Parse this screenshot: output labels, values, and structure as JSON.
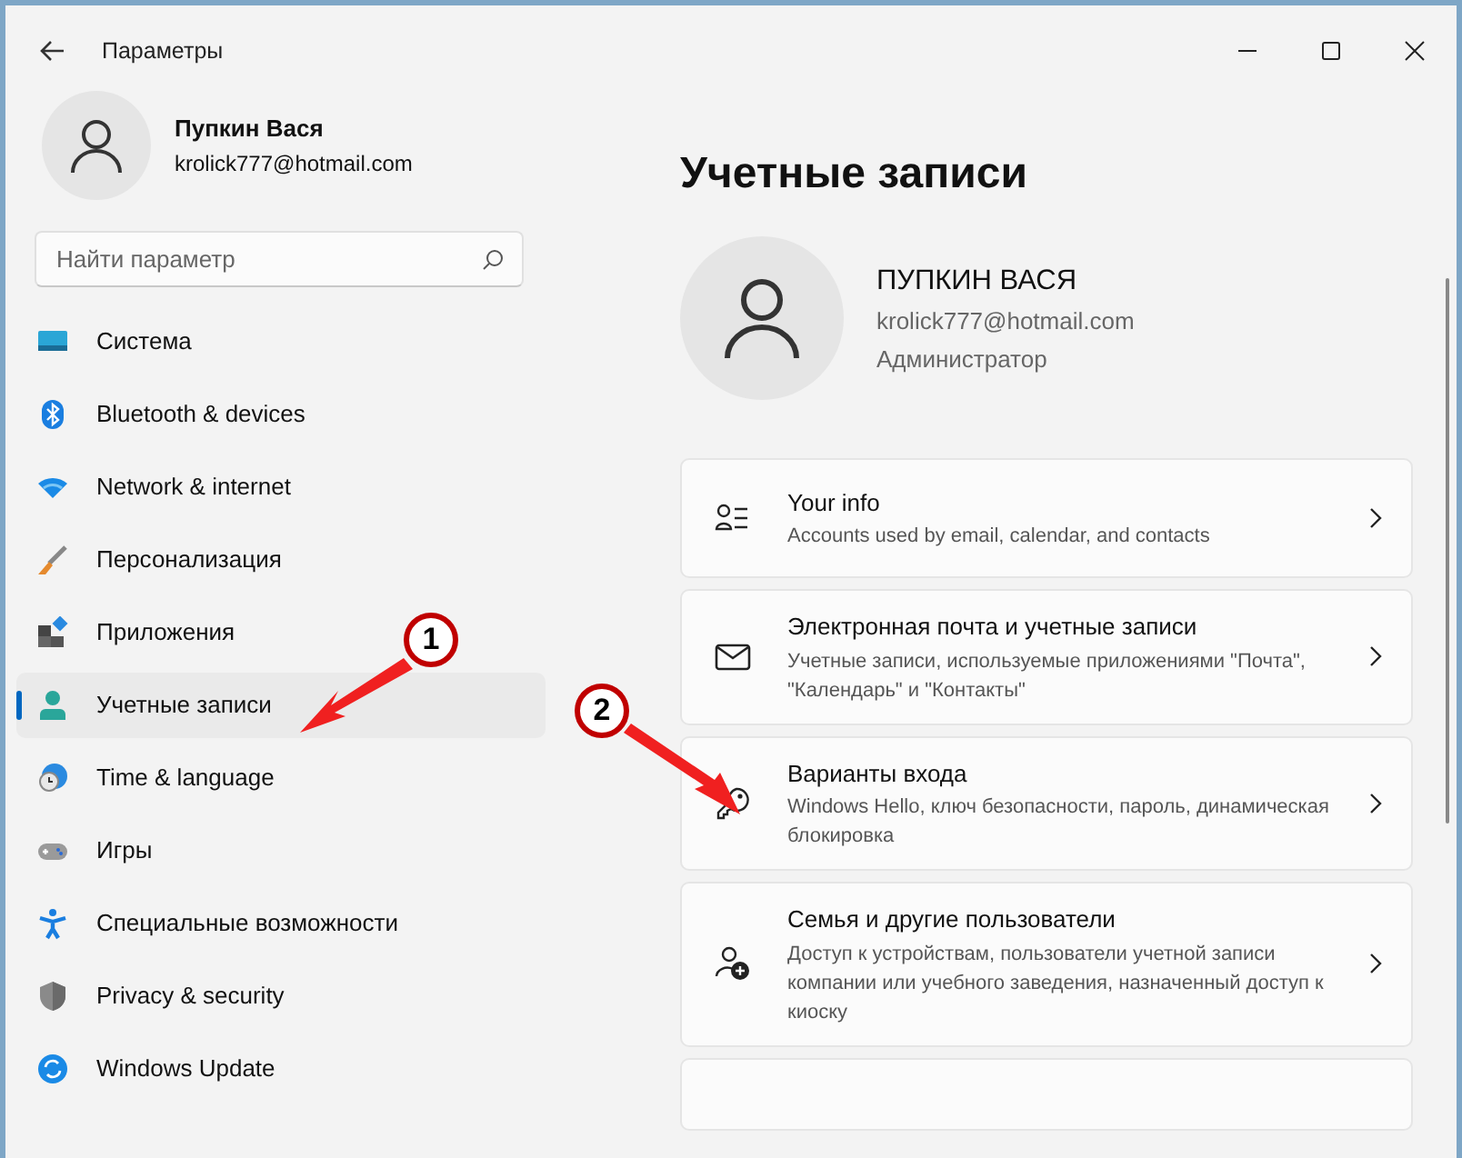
{
  "window": {
    "title": "Параметры"
  },
  "user": {
    "name": "Пупкин Вася",
    "email": "krolick777@hotmail.com"
  },
  "search": {
    "placeholder": "Найти параметр"
  },
  "sidebar": {
    "items": [
      {
        "label": "Система",
        "selected": false
      },
      {
        "label": "Bluetooth & devices",
        "selected": false
      },
      {
        "label": "Network & internet",
        "selected": false
      },
      {
        "label": "Персонализация",
        "selected": false
      },
      {
        "label": "Приложения",
        "selected": false
      },
      {
        "label": "Учетные записи",
        "selected": true
      },
      {
        "label": "Time & language",
        "selected": false
      },
      {
        "label": "Игры",
        "selected": false
      },
      {
        "label": "Специальные возможности",
        "selected": false
      },
      {
        "label": "Privacy & security",
        "selected": false
      },
      {
        "label": "Windows Update",
        "selected": false
      }
    ]
  },
  "page": {
    "heading": "Учетные записи",
    "profile": {
      "name": "ПУПКИН ВАСЯ",
      "email": "krolick777@hotmail.com",
      "role": "Администратор"
    },
    "cards": [
      {
        "kind": "link",
        "title": "Your info",
        "description": "Accounts used by email, calendar, and contacts"
      },
      {
        "kind": "link",
        "title": "Электронная почта и учетные записи",
        "description": "Учетные записи, используемые приложениями \"Почта\", \"Календарь\" и \"Контакты\""
      },
      {
        "kind": "link",
        "title": "Варианты входа",
        "description": "Windows Hello, ключ безопасности, пароль, динамическая блокировка"
      },
      {
        "kind": "link",
        "title": "Семья и другие пользователи",
        "description": "Доступ к устройствам, пользователи учетной записи компании или учебного заведения, назначенный доступ к киоску"
      },
      {
        "kind": "cut"
      }
    ]
  },
  "annotations": [
    {
      "label": "1"
    },
    {
      "label": "2"
    }
  ]
}
